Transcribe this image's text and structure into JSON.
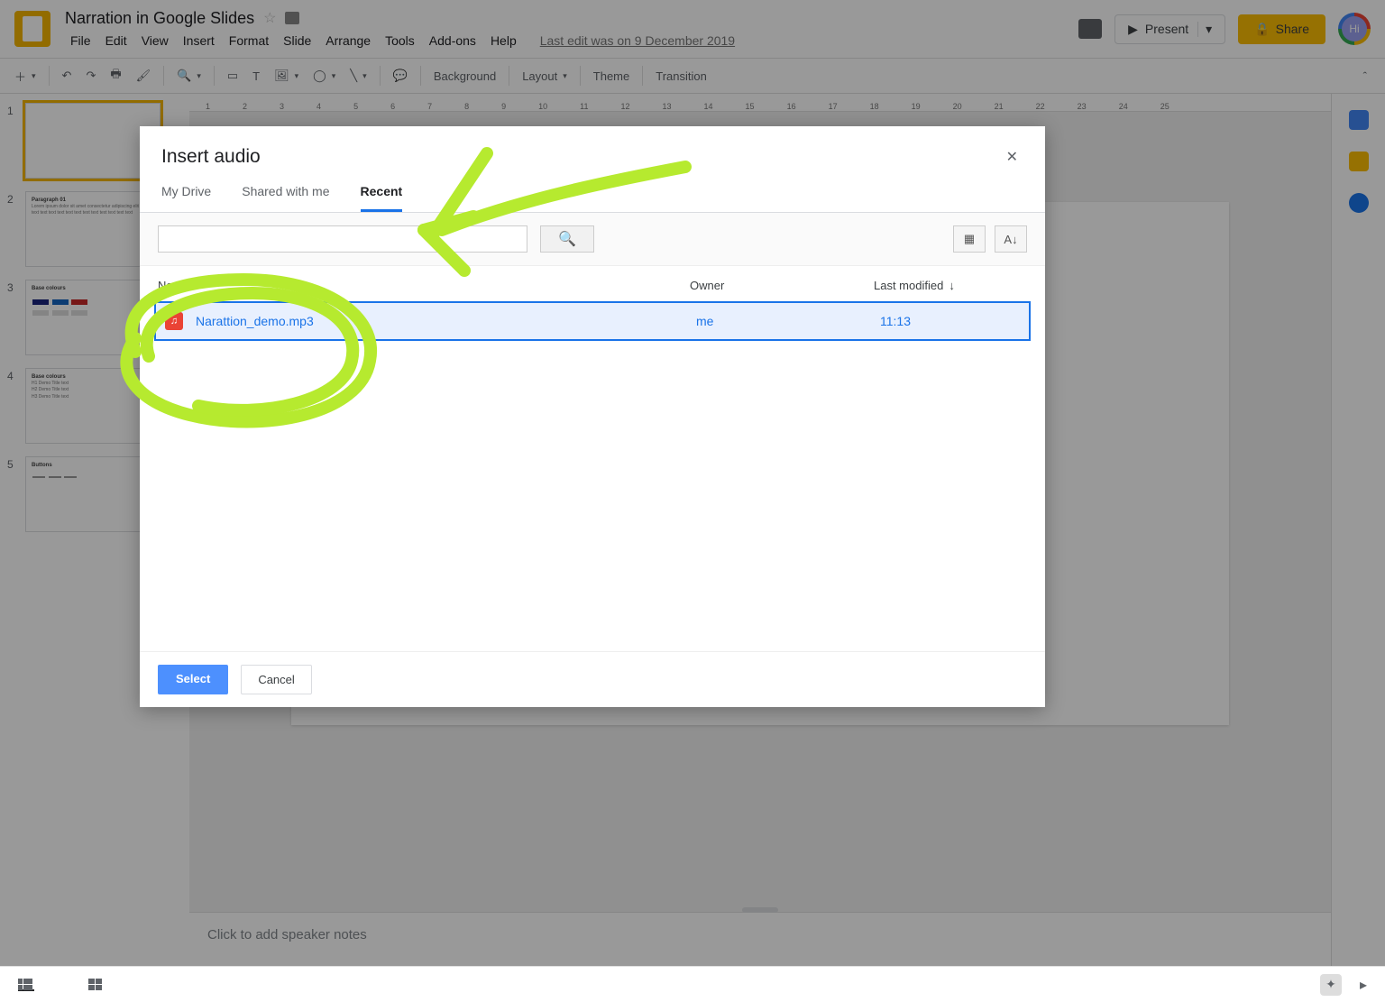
{
  "header": {
    "doc_title": "Narration in Google Slides",
    "menus": [
      "File",
      "Edit",
      "View",
      "Insert",
      "Format",
      "Slide",
      "Arrange",
      "Tools",
      "Add-ons",
      "Help"
    ],
    "last_edit": "Last edit was on 9 December 2019",
    "present_label": "Present",
    "share_label": "Share",
    "avatar_initials": "Hi"
  },
  "toolbar": {
    "background": "Background",
    "layout": "Layout",
    "theme": "Theme",
    "transition": "Transition"
  },
  "slides": [
    {
      "num": "1",
      "title": "",
      "body": ""
    },
    {
      "num": "2",
      "title": "Paragraph 01",
      "body": "Lorem ipsum dolor sit amet consectetur adipiscing elit text text text text text text text text text text text text text"
    },
    {
      "num": "3",
      "title": "Base colours",
      "body": ""
    },
    {
      "num": "4",
      "title": "Base colours",
      "body": "H1 Demo Title text\nH2 Demo Title text\nH3 Demo Title text"
    },
    {
      "num": "5",
      "title": "Buttons",
      "body": ""
    }
  ],
  "ruler_ticks": [
    "1",
    "2",
    "3",
    "4",
    "5",
    "6",
    "7",
    "8",
    "9",
    "10",
    "11",
    "12",
    "13",
    "14",
    "15",
    "16",
    "17",
    "18",
    "19",
    "20",
    "21",
    "22",
    "23",
    "24",
    "25"
  ],
  "notes": {
    "placeholder": "Click to add speaker notes"
  },
  "dialog": {
    "title": "Insert audio",
    "tabs": [
      "My Drive",
      "Shared with me",
      "Recent"
    ],
    "active_tab": 2,
    "columns": {
      "name": "Name",
      "owner": "Owner",
      "modified": "Last modified"
    },
    "file": {
      "name": "Narattion_demo.mp3",
      "owner": "me",
      "modified": "11:13"
    },
    "select_label": "Select",
    "cancel_label": "Cancel"
  }
}
